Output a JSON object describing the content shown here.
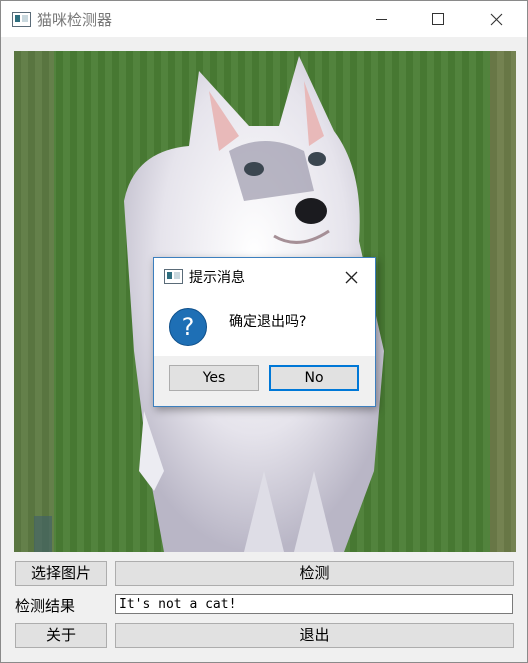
{
  "window": {
    "title": "猫咪检测器"
  },
  "titlebar": {
    "minimize_icon": "minimize-icon",
    "maximize_icon": "maximize-icon",
    "close_icon": "close-icon"
  },
  "controls": {
    "select_image_label": "选择图片",
    "detect_label": "检测",
    "result_label": "检测结果",
    "result_value": "It's not a cat!",
    "about_label": "关于",
    "exit_label": "退出"
  },
  "dialog": {
    "title": "提示消息",
    "message": "确定退出吗?",
    "yes_label": "Yes",
    "no_label": "No",
    "icon": "question-icon",
    "icon_glyph": "?"
  }
}
